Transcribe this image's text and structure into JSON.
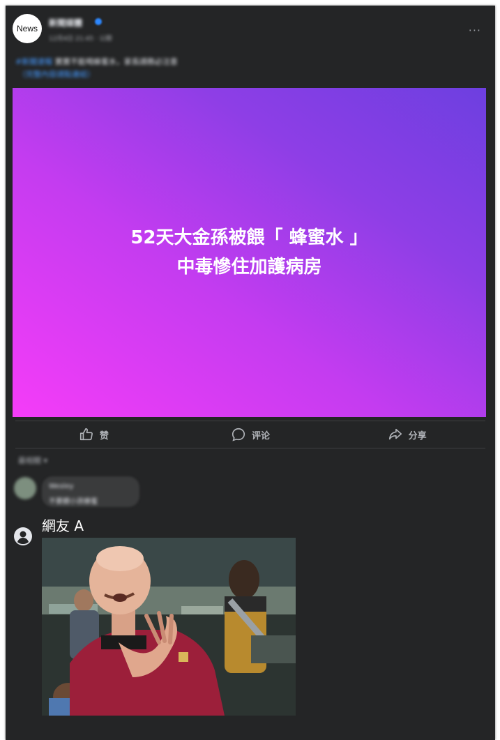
{
  "post": {
    "avatar_text": "News",
    "page_name": "新聞媒體",
    "meta": "12月4日 21:45 · 公開",
    "more": "···",
    "caption_tag": "#新聞速報",
    "caption": "寶寶不能喝蜂蜜水，家長請務必注意",
    "caption_line2": "（完整內容請點連結）"
  },
  "banner": {
    "line1": "52天大金孫被餵「 蜂蜜水 」",
    "line2": "中毒慘住加護病房",
    "color_start": "#f53cf8",
    "color_end": "#6d3fe0"
  },
  "actions": [
    {
      "label": "赞",
      "icon": "thumbs-up-icon"
    },
    {
      "label": "评论",
      "icon": "comment-icon"
    },
    {
      "label": "分享",
      "icon": "share-icon"
    }
  ],
  "comments": {
    "sort_label": "最相關 ▾",
    "first": {
      "name": "Wesley",
      "text": "不要餵小孩蜂蜜"
    },
    "reply": {
      "username": "網友 A",
      "image": "meme-image"
    }
  }
}
